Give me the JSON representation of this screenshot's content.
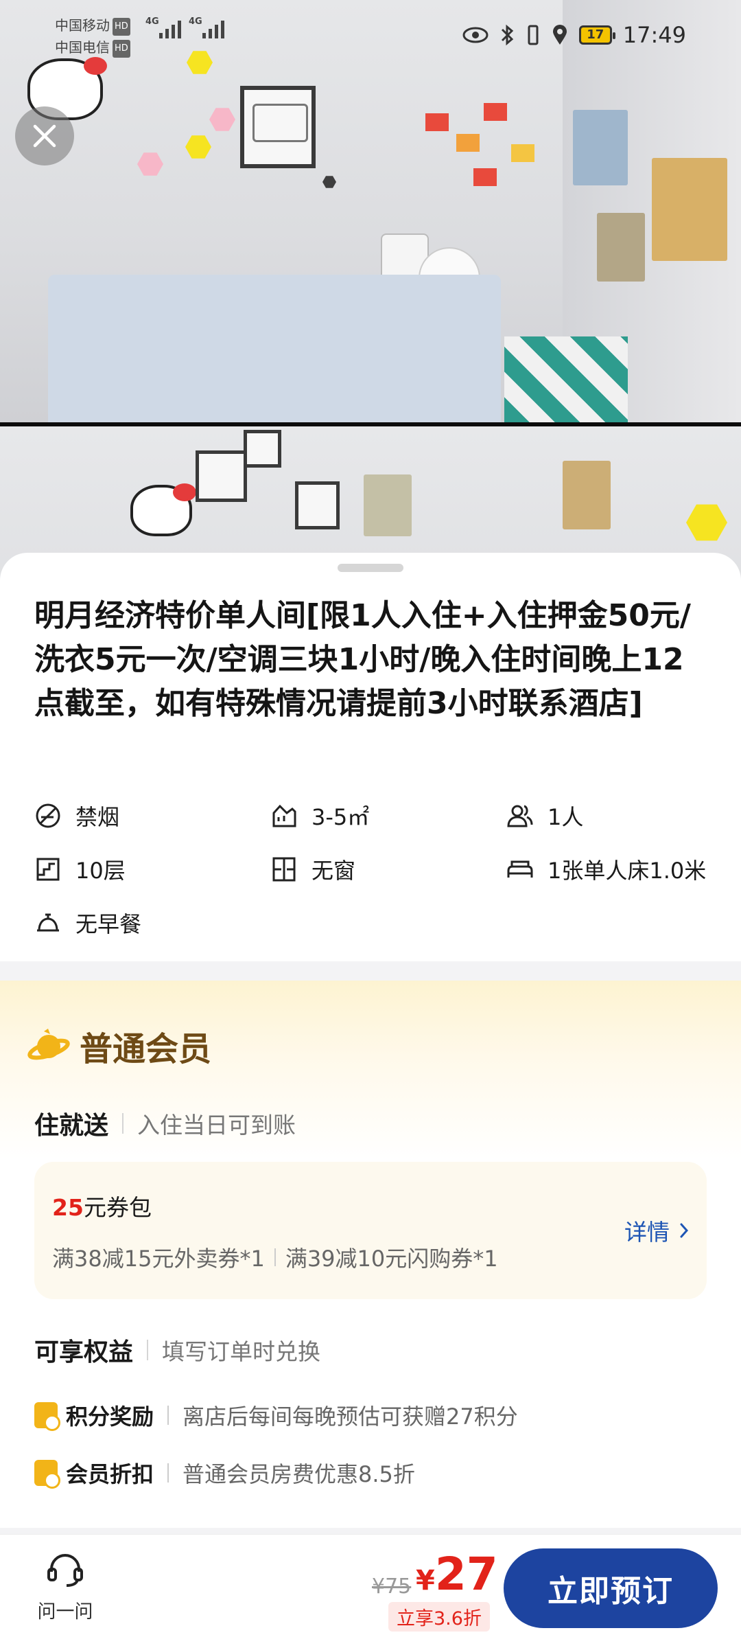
{
  "status_bar": {
    "carrier_1": "中国移动",
    "carrier_2": "中国电信",
    "hd_badge": "HD",
    "network_1": "4G",
    "network_2": "4G",
    "battery": "17",
    "time": "17:49"
  },
  "room": {
    "title": "明月经济特价单人间[限1人入住+入住押金50元/洗衣5元一次/空调三块1小时/晚入住时间晚上12点截至，如有特殊情况请提前3小时联系酒店]",
    "facilities": [
      {
        "icon": "no-smoking-icon",
        "label": "禁烟"
      },
      {
        "icon": "area-icon",
        "label": "3-5㎡"
      },
      {
        "icon": "people-icon",
        "label": "1人"
      },
      {
        "icon": "floor-icon",
        "label": "10层"
      },
      {
        "icon": "window-icon",
        "label": "无窗"
      },
      {
        "icon": "bed-icon",
        "label": "1张单人床1.0米"
      },
      {
        "icon": "service-bell-icon",
        "label": "无早餐"
      }
    ]
  },
  "member": {
    "title": "普通会员",
    "stay_gift": {
      "label": "住就送",
      "note": "入住当日可到账"
    },
    "coupon": {
      "amount": "25",
      "suffix": "元券包",
      "item_1": "满38减15元外卖券*1",
      "item_2": "满39减10元闪购券*1",
      "detail_label": "详情"
    },
    "benefits_head": {
      "label": "可享权益",
      "note": "填写订单时兑换"
    },
    "benefits": [
      {
        "name": "积分奖励",
        "desc": "离店后每间每晚预估可获赠27积分"
      },
      {
        "name": "会员折扣",
        "desc": "普通会员房费优惠8.5折"
      }
    ]
  },
  "bottom_bar": {
    "ask_label": "问一问",
    "original_price": "¥75",
    "currency": "¥",
    "price": "27",
    "discount_tag": "立享3.6折",
    "book_label": "立即预订"
  },
  "colors": {
    "accent_blue": "#1d44a0",
    "price_red": "#e2231a",
    "member_brown": "#6e4a15",
    "member_gold": "#f2b418"
  }
}
